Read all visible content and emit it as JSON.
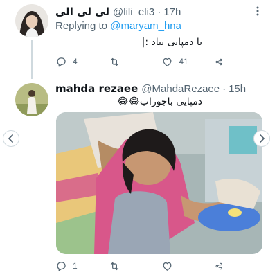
{
  "tweets": [
    {
      "display_name": "لی لی الی",
      "handle": "@lili_eli3",
      "dot": "·",
      "time": "17h",
      "replying_label": "Replying to",
      "replying_to": "@maryam_hna",
      "text": "با دمپایی بیاد :|",
      "reply_count": "4",
      "retweet_count": "",
      "like_count": "41"
    },
    {
      "display_name": "mahda rezaee",
      "handle": "@MahdaRezaee",
      "dot": "·",
      "time": "15h",
      "text": "دمپایی باجوراب😂😂",
      "reply_count": "1",
      "retweet_count": "",
      "like_count": ""
    }
  ],
  "icons": {
    "reply": "comment-icon",
    "retweet": "retweet-icon",
    "like": "heart-icon",
    "share": "share-icon",
    "more": "more-vertical-icon",
    "prev": "chevron-left-icon",
    "next": "chevron-right-icon"
  },
  "colors": {
    "accent": "#1d9bf0",
    "secondary_text": "#536471",
    "primary_text": "#0f1419",
    "divider": "#eff3f4"
  }
}
